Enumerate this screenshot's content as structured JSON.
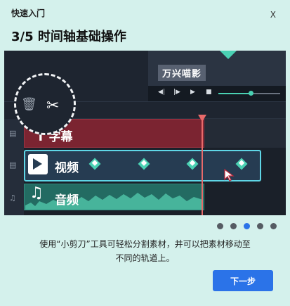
{
  "header": {
    "eyebrow": "快速入门",
    "close_label": "X"
  },
  "title": "3/5 时间轴基础操作",
  "illustration": {
    "preview_watermark": "万兴喵影",
    "controls": [
      "◀|",
      "|▶",
      "▶",
      "■"
    ],
    "tracks": {
      "title_label": "字幕",
      "video_label": "视频",
      "audio_label": "音频"
    },
    "accent_color": "#4ad1b3",
    "playhead_color": "#e86a6a"
  },
  "pagination": {
    "total": 5,
    "current": 3
  },
  "description_line1": "使用“小剪刀”工具可轻松分割素材，并可以把素材移动至",
  "description_line2": "不同的轨道上。",
  "next_label": "下一步",
  "brand_color": "#2b73e8"
}
